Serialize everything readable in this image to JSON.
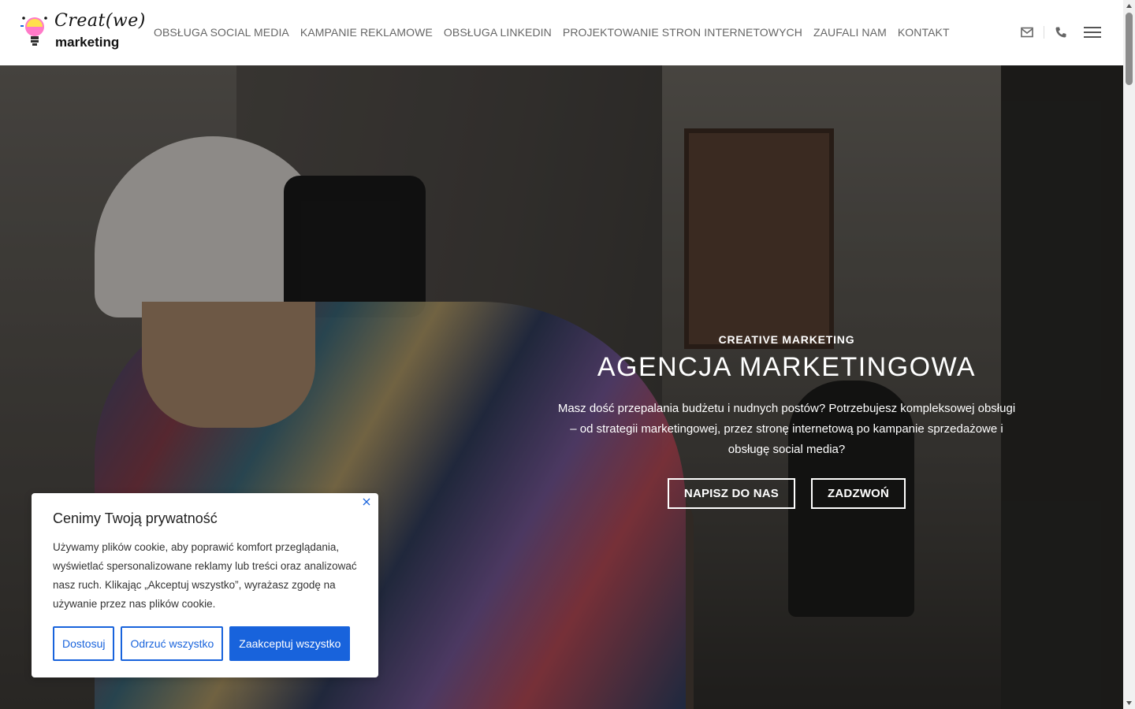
{
  "brand": {
    "logo_line1": "Creat(we)",
    "logo_line2": "marketing"
  },
  "nav": {
    "items": [
      "OBSŁUGA SOCIAL MEDIA",
      "KAMPANIE REKLAMOWE",
      "OBSŁUGA LINKEDIN",
      "PROJEKTOWANIE STRON INTERNETOWYCH",
      "ZAUFALI NAM",
      "KONTAKT"
    ]
  },
  "header_icons": [
    "mail-icon",
    "phone-icon",
    "hamburger-menu-icon"
  ],
  "hero": {
    "kicker": "CREATIVE MARKETING",
    "title": "AGENCJA MARKETINGOWA",
    "text": "Masz dość przepalania budżetu i nudnych postów? Potrzebujesz kompleksowej obsługi – od strategii marketingowej, przez stronę internetową po kampanie sprzedażowe i obsługę social media?",
    "button_write": "NAPISZ DO NAS",
    "button_call": "ZADZWOŃ"
  },
  "cookie": {
    "title": "Cenimy Twoją prywatność",
    "text": "Używamy plików cookie, aby poprawić komfort przeglądania, wyświetlać spersonalizowane reklamy lub treści oraz analizować nasz ruch. Klikając „Akceptuj wszystko”, wyrażasz zgodę na używanie przez nas plików cookie.",
    "customize": "Dostosuj",
    "reject": "Odrzuć wszystko",
    "accept": "Zaakceptuj wszystko"
  },
  "colors": {
    "accent": "#1863dc",
    "nav_text": "#666666"
  }
}
